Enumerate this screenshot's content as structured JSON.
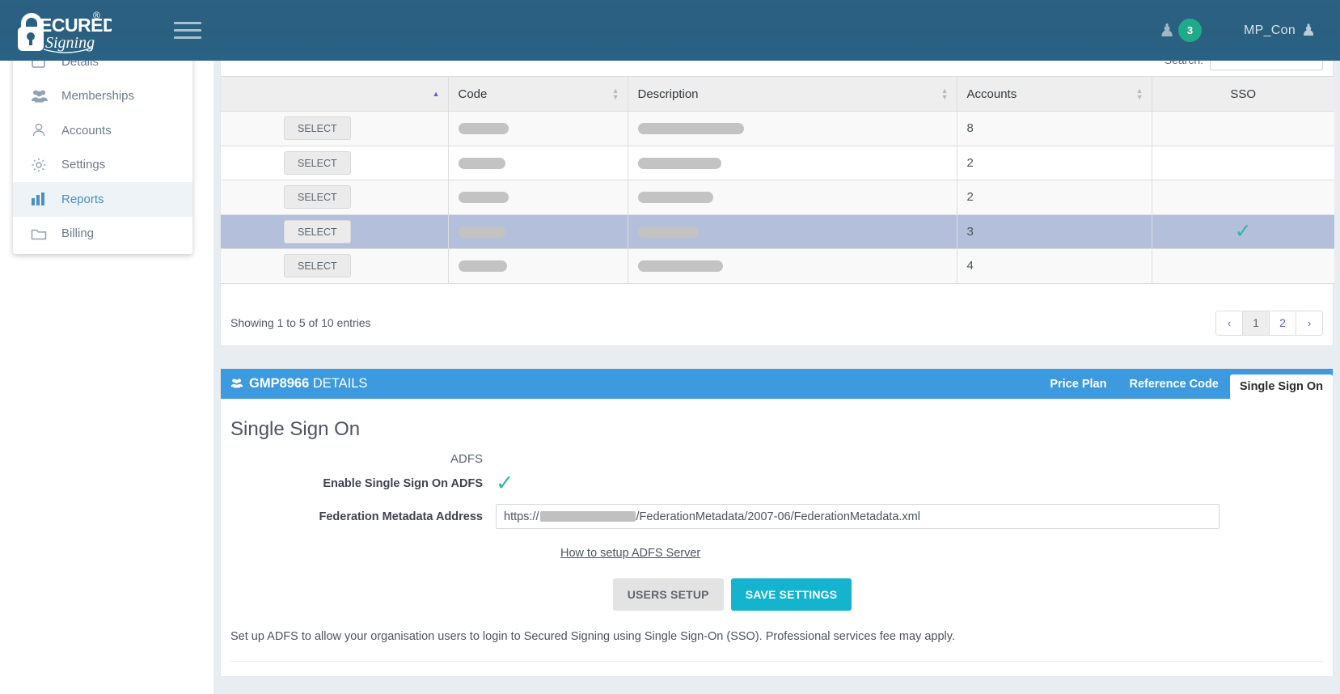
{
  "topbar": {
    "logo_text": "SECURED Signing",
    "logo_registered": "®",
    "menu_icon": "hamburger-icon",
    "notif_icon": "person-icon",
    "notif_count": "3",
    "account_name": "MP_Con",
    "account_icon": "person-icon"
  },
  "sidebar": {
    "items": [
      {
        "label": "Details",
        "icon": "document-icon",
        "active": false
      },
      {
        "label": "Memberships",
        "icon": "users-icon",
        "active": false
      },
      {
        "label": "Accounts",
        "icon": "user-outline-icon",
        "active": false
      },
      {
        "label": "Settings",
        "icon": "gear-icon",
        "active": false
      },
      {
        "label": "Reports",
        "icon": "bar-chart-icon",
        "active": true
      },
      {
        "label": "Billing",
        "icon": "folder-icon",
        "active": false
      }
    ]
  },
  "table": {
    "search_label": "Search:",
    "search_value": "",
    "search_placeholder": "",
    "columns": [
      {
        "label": "",
        "sort": "asc"
      },
      {
        "label": "Code",
        "sort": "both"
      },
      {
        "label": "Description",
        "sort": "both"
      },
      {
        "label": "Accounts",
        "sort": "both"
      },
      {
        "label": "SSO",
        "sort": "none"
      }
    ],
    "select_label": "SELECT",
    "rows": [
      {
        "code_width": 62,
        "desc_width": 131,
        "accounts": "8",
        "sso": "",
        "selected": false
      },
      {
        "code_width": 58,
        "desc_width": 103,
        "accounts": "2",
        "sso": "",
        "selected": false
      },
      {
        "code_width": 62,
        "desc_width": 93,
        "accounts": "2",
        "sso": "",
        "selected": false
      },
      {
        "code_width": 58,
        "desc_width": 75,
        "accounts": "3",
        "sso": "✓",
        "selected": true
      },
      {
        "code_width": 60,
        "desc_width": 105,
        "accounts": "4",
        "sso": "",
        "selected": false
      }
    ],
    "entries_info": "Showing 1 to 5 of 10 entries",
    "pager": [
      {
        "label": "‹",
        "name": "prev",
        "active": false
      },
      {
        "label": "1",
        "name": "page-1",
        "active": true
      },
      {
        "label": "2",
        "name": "page-2",
        "active": false
      },
      {
        "label": "›",
        "name": "next",
        "active": false
      }
    ]
  },
  "details": {
    "header_icon": "group-icon",
    "header_code": "GMP8966",
    "header_suffix": " DETAILS",
    "tabs": [
      {
        "label": "Price Plan",
        "active": false
      },
      {
        "label": "Reference Code",
        "active": false
      },
      {
        "label": "Single Sign On",
        "active": true
      }
    ],
    "section_title": "Single Sign On",
    "adfs_label": "ADFS",
    "enable_label": "Enable Single Sign On ADFS",
    "enable_checked": "✓",
    "metadata_label": "Federation Metadata Address",
    "metadata_url_prefix": "https://",
    "metadata_url_suffix": "/FederationMetadata/2007-06/FederationMetadata.xml",
    "help_link": "How to setup ADFS Server",
    "users_setup_label": "USERS SETUP",
    "save_settings_label": "SAVE SETTINGS",
    "note": "Set up ADFS to allow your organisation users to login to Secured Signing using Single Sign-On (SSO). Professional services fee may apply."
  },
  "colors": {
    "topbar": "#2a5f80",
    "accent_blue": "#3d9ade",
    "primary_cyan": "#14b4cf",
    "badge_green": "#1fab89",
    "check_teal": "#31b7a9",
    "row_selected": "#b3bfdb"
  }
}
